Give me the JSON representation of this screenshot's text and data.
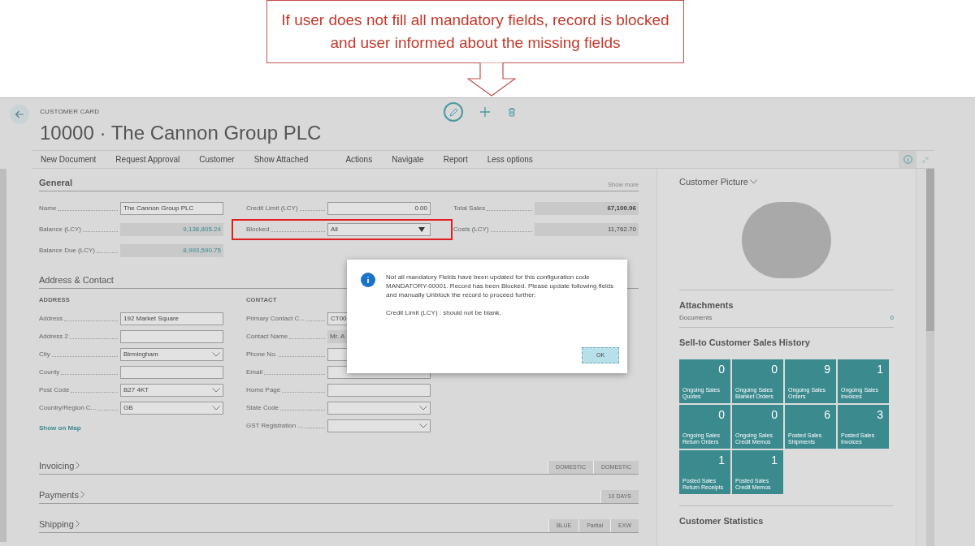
{
  "callout": {
    "text": "If user does not fill all mandatory fields, record is blocked and user informed about the missing fields"
  },
  "page": {
    "caption": "CUSTOMER CARD",
    "title": "10000 · The Cannon Group PLC"
  },
  "actions": [
    "New Document",
    "Request Approval",
    "Customer",
    "Show Attached",
    "Actions",
    "Navigate",
    "Report",
    "Less options"
  ],
  "general": {
    "title": "General",
    "show_more": "Show more",
    "columns": [
      [
        {
          "label": "Name",
          "value": "The Cannon Group PLC",
          "kind": "input",
          "highlighted": false
        },
        {
          "label": "Balance (LCY)",
          "value": "9,138,805.24",
          "kind": "link-amount",
          "highlighted": false
        },
        {
          "label": "Balance Due (LCY)",
          "value": "8,993,590.75",
          "kind": "link-amount",
          "highlighted": false
        }
      ],
      [
        {
          "label": "Credit Limit (LCY)",
          "value": "0.00",
          "kind": "number-input",
          "highlighted": false
        },
        {
          "label": "Blocked",
          "value": "All",
          "kind": "select",
          "highlighted": true
        }
      ],
      [
        {
          "label": "Total Sales",
          "value": "67,100.96",
          "kind": "total",
          "highlighted": false
        },
        {
          "label": "Costs (LCY)",
          "value": "11,762.70",
          "kind": "amount",
          "highlighted": false
        }
      ]
    ]
  },
  "address_contact": {
    "title": "Address & Contact",
    "groups": [
      {
        "heading": "ADDRESS",
        "fields": [
          {
            "label": "Address",
            "value": "192 Market Square",
            "kind": "input"
          },
          {
            "label": "Address 2",
            "kind": "input"
          },
          {
            "label": "City",
            "value": "Birmingham",
            "kind": "dropdown"
          },
          {
            "label": "County",
            "kind": "input"
          },
          {
            "label": "Post Code",
            "value": "B27 4KT",
            "kind": "dropdown"
          },
          {
            "label": "Country/Region C...",
            "value": "GB",
            "kind": "dropdown"
          }
        ],
        "link": "Show on Map"
      },
      {
        "heading": "CONTACT",
        "fields": [
          {
            "label": "Primary Contact C...",
            "value": "CT00",
            "kind": "input"
          },
          {
            "label": "Contact Name",
            "value": "Mr. A",
            "kind": "readonly"
          },
          {
            "label": "Phone No.",
            "kind": "input"
          },
          {
            "label": "Email",
            "kind": "input"
          },
          {
            "label": "Home Page",
            "kind": "input"
          },
          {
            "label": "State Code",
            "kind": "dropdown"
          },
          {
            "label": "GST Registration ...",
            "kind": "dropdown"
          }
        ]
      }
    ]
  },
  "collapsed_sections": [
    {
      "title": "Invoicing",
      "badges": [
        "DOMESTIC",
        "DOMESTIC"
      ]
    },
    {
      "title": "Payments",
      "badges": [
        "10 DAYS"
      ]
    },
    {
      "title": "Shipping",
      "badges": [
        "BLUE",
        "Partial",
        "EXW"
      ]
    }
  ],
  "factbox": {
    "picture_title": "Customer Picture",
    "attachments": {
      "title": "Attachments",
      "label": "Documents",
      "count": "0"
    },
    "history": {
      "title": "Sell-to Customer Sales History",
      "tiles": [
        {
          "count": "0",
          "label": "Ongoing Sales Quotes"
        },
        {
          "count": "0",
          "label": "Ongoing Sales Blanket Orders"
        },
        {
          "count": "9",
          "label": "Ongoing Sales Orders"
        },
        {
          "count": "1",
          "label": "Ongoing Sales Invoices"
        },
        {
          "count": "0",
          "label": "Ongoing Sales Return Orders"
        },
        {
          "count": "0",
          "label": "Ongoing Sales Credit Memos"
        },
        {
          "count": "6",
          "label": "Posted Sales Shipments"
        },
        {
          "count": "3",
          "label": "Posted Sales Invoices"
        },
        {
          "count": "1",
          "label": "Posted Sales Return Receipts"
        },
        {
          "count": "1",
          "label": "Posted Sales Credit Memos"
        }
      ]
    },
    "statistics_title": "Customer Statistics"
  },
  "dialog": {
    "message": "Not all mandatory Fields have been updated for this configuration code MANDATORY-00001. Record has been Blocked. Please update following fields and manually Unblock the record to proceed further:",
    "detail": "Credit Limit (LCY) : should not be blank.",
    "button": "OK"
  }
}
